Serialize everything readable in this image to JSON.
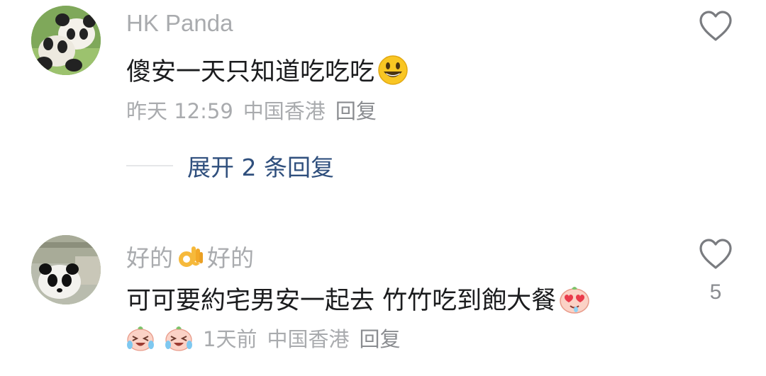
{
  "comments": [
    {
      "username": "HK Panda",
      "text": "傻安一天只知道吃吃吃",
      "text_emoji": "smiley-emoji",
      "time": "昨天 12:59",
      "location": "中国香港",
      "reply_label": "回复",
      "expand_label": "展开 2 条回复",
      "like_count": ""
    },
    {
      "username_part1": "好的",
      "username_emoji": "ok-hand-emoji",
      "username_part2": "好的",
      "text": "可可要約宅男安一起去 竹竹吃到飽大餐",
      "text_emoji": "heart-eyes-emoji",
      "meta_emojis": [
        "crying-laugh-emoji",
        "crying-laugh-emoji"
      ],
      "time": "1天前",
      "location": "中国香港",
      "reply_label": "回复",
      "like_count": "5"
    }
  ],
  "colors": {
    "username": "#a9abae",
    "text": "#1b1c1e",
    "meta": "#a9abae",
    "expand": "#2f4f7d"
  }
}
